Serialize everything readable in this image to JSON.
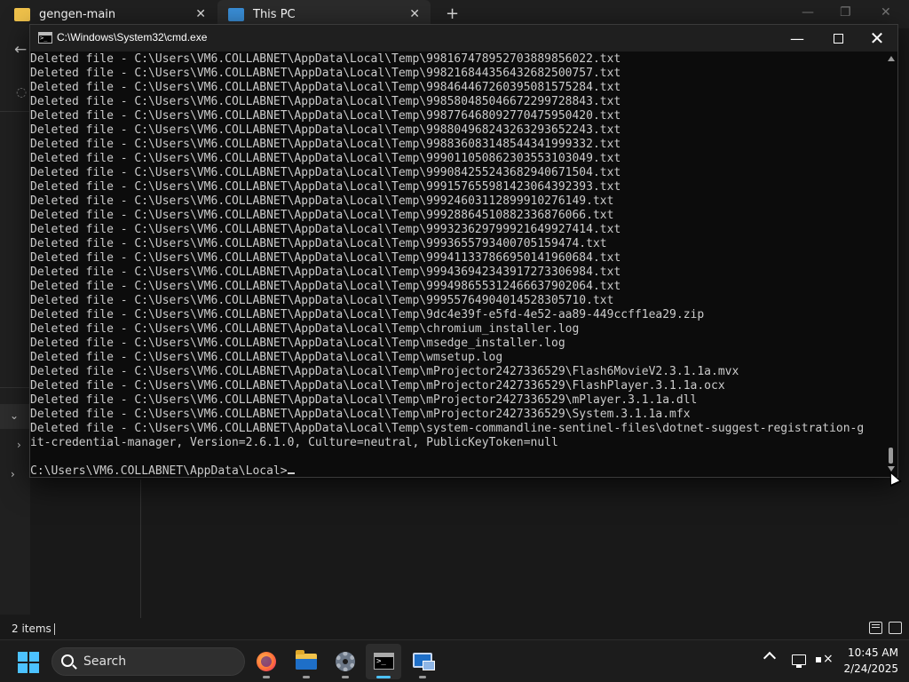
{
  "explorer": {
    "tab1_title": "gengen-main",
    "tab2_title": "This PC",
    "new_tab_label": "+",
    "status_items": "2 items"
  },
  "cmd": {
    "title": "C:\\Windows\\System32\\cmd.exe",
    "lines": [
      "Deleted file - C:\\Users\\VM6.COLLABNET\\AppData\\Local\\Temp\\998167478952703889856022.txt",
      "Deleted file - C:\\Users\\VM6.COLLABNET\\AppData\\Local\\Temp\\998216844356432682500757.txt",
      "Deleted file - C:\\Users\\VM6.COLLABNET\\AppData\\Local\\Temp\\998464467260395081575284.txt",
      "Deleted file - C:\\Users\\VM6.COLLABNET\\AppData\\Local\\Temp\\998580485046672299728843.txt",
      "Deleted file - C:\\Users\\VM6.COLLABNET\\AppData\\Local\\Temp\\998776468092770475950420.txt",
      "Deleted file - C:\\Users\\VM6.COLLABNET\\AppData\\Local\\Temp\\998804968243263293652243.txt",
      "Deleted file - C:\\Users\\VM6.COLLABNET\\AppData\\Local\\Temp\\998836083148544341999332.txt",
      "Deleted file - C:\\Users\\VM6.COLLABNET\\AppData\\Local\\Temp\\999011050862303553103049.txt",
      "Deleted file - C:\\Users\\VM6.COLLABNET\\AppData\\Local\\Temp\\999084255243682940671504.txt",
      "Deleted file - C:\\Users\\VM6.COLLABNET\\AppData\\Local\\Temp\\999157655981423064392393.txt",
      "Deleted file - C:\\Users\\VM6.COLLABNET\\AppData\\Local\\Temp\\9992460311289991027614​9.txt",
      "Deleted file - C:\\Users\\VM6.COLLABNET\\AppData\\Local\\Temp\\99928864510882336876066.txt",
      "Deleted file - C:\\Users\\VM6.COLLABNET\\AppData\\Local\\Temp\\999323629799921649927414.txt",
      "Deleted file - C:\\Users\\VM6.COLLABNET\\AppData\\Local\\Temp\\99936557934007051594​74.txt",
      "Deleted file - C:\\Users\\VM6.COLLABNET\\AppData\\Local\\Temp\\999411337866950141960684.txt",
      "Deleted file - C:\\Users\\VM6.COLLABNET\\AppData\\Local\\Temp\\999436942343917273306984.txt",
      "Deleted file - C:\\Users\\VM6.COLLABNET\\AppData\\Local\\Temp\\999498655312466637902064.txt",
      "Deleted file - C:\\Users\\VM6.COLLABNET\\AppData\\Local\\Temp\\999557649040145283057​10.txt",
      "Deleted file - C:\\Users\\VM6.COLLABNET\\AppData\\Local\\Temp\\9dc4e39f-e5fd-4e52-aa89-449ccff1ea29.zip",
      "Deleted file - C:\\Users\\VM6.COLLABNET\\AppData\\Local\\Temp\\chromium_installer.log",
      "Deleted file - C:\\Users\\VM6.COLLABNET\\AppData\\Local\\Temp\\msedge_installer.log",
      "Deleted file - C:\\Users\\VM6.COLLABNET\\AppData\\Local\\Temp\\wmsetup.log",
      "Deleted file - C:\\Users\\VM6.COLLABNET\\AppData\\Local\\Temp\\mProjector2427336529\\Flash6MovieV2.3.1.1a.mvx",
      "Deleted file - C:\\Users\\VM6.COLLABNET\\AppData\\Local\\Temp\\mProjector2427336529\\FlashPlayer.3.1.1a.ocx",
      "Deleted file - C:\\Users\\VM6.COLLABNET\\AppData\\Local\\Temp\\mProjector2427336529\\mPlayer.3.1.1a.dll",
      "Deleted file - C:\\Users\\VM6.COLLABNET\\AppData\\Local\\Temp\\mProjector2427336529\\System.3.1.1a.mfx",
      "Deleted file - C:\\Users\\VM6.COLLABNET\\AppData\\Local\\Temp\\system-commandline-sentinel-files\\dotnet-suggest-registration-g",
      "it-credential-manager, Version=2.6.1.0, Culture=neutral, PublicKeyToken=null",
      ""
    ],
    "prompt": "C:\\Users\\VM6.COLLABNET\\AppData\\Local>"
  },
  "taskbar": {
    "search_label": "Search",
    "apps": [
      "firefox-icon",
      "file-explorer-icon",
      "settings-icon",
      "command-prompt-icon",
      "remote-desktop-icon"
    ],
    "active_app": "command-prompt-icon",
    "accent_color": "#4cc2ff"
  },
  "clock": {
    "time": "10:45 AM",
    "date": "2/24/2025"
  }
}
